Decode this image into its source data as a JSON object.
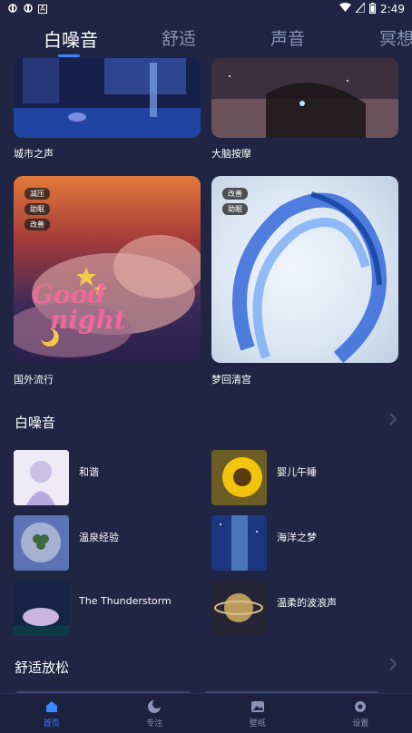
{
  "status_bar": {
    "time": "2:49",
    "left_icons": [
      "notification-icon",
      "notification-icon",
      "a-icon"
    ],
    "right_icons": [
      "wifi-icon",
      "signal-icon",
      "battery-icon"
    ]
  },
  "tabs": [
    {
      "label": "白噪音",
      "active": true
    },
    {
      "label": "舒适",
      "active": false
    },
    {
      "label": "声音",
      "active": false
    },
    {
      "label": "冥想",
      "active": false
    }
  ],
  "featured": [
    {
      "label": "城市之声",
      "tags": []
    },
    {
      "label": "大脑按摩",
      "tags": []
    },
    {
      "label": "国外流行",
      "tags": [
        "减压",
        "助眠",
        "改善"
      ]
    },
    {
      "label": "梦回清宫",
      "tags": [
        "改善",
        "助眠"
      ]
    }
  ],
  "goodnight_art_text": [
    "Good",
    "night"
  ],
  "section_white_noise": {
    "title": "白噪音",
    "items": [
      {
        "label": "和谐"
      },
      {
        "label": "婴儿午睡"
      },
      {
        "label": "温泉经验"
      },
      {
        "label": "海洋之梦"
      },
      {
        "label": "The Thunderstorm"
      },
      {
        "label": "温柔的波浪声"
      }
    ]
  },
  "section_relax": {
    "title": "舒适放松"
  },
  "bottom_nav": [
    {
      "label": "首页",
      "icon": "home-icon",
      "active": true
    },
    {
      "label": "专注",
      "icon": "moon-icon",
      "active": false
    },
    {
      "label": "壁纸",
      "icon": "image-icon",
      "active": false
    },
    {
      "label": "设置",
      "icon": "gear-icon",
      "active": false
    }
  ],
  "colors": {
    "background": "#1f2542",
    "accent": "#3d84ff",
    "inactive_text": "#8a93b8"
  }
}
